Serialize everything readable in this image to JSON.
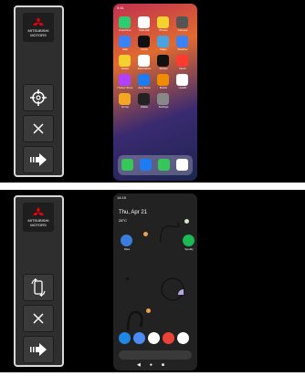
{
  "panels": [
    {
      "sidebar": {
        "logo_text_1": "MITSUBISHI",
        "logo_text_2": "MOTORS",
        "buttons": [
          "crosshair-icon",
          "close-icon",
          "forward-arrow-icon"
        ]
      },
      "phone": {
        "os": "ios",
        "status_time": "9:41",
        "app_labels": [
          "FaceTime",
          "Calendar",
          "Photos",
          "Camera",
          "Mail",
          "Clock",
          "Maps",
          "Weather",
          "Notes",
          "Reminders",
          "Stocks",
          "News",
          "iTunes Store",
          "App Store",
          "Books",
          "Health",
          "Home",
          "Wallet",
          "Settings"
        ],
        "dock_icons": [
          "phone-icon",
          "safari-icon",
          "messages-icon",
          "music-icon"
        ]
      }
    },
    {
      "sidebar": {
        "logo_text_1": "MITSUBISHI",
        "logo_text_2": "MOTORS",
        "buttons": [
          "rotate-phone-icon",
          "close-icon",
          "forward-arrow-icon"
        ]
      },
      "phone": {
        "os": "android",
        "status_time": "14:15",
        "date": "Thu, Apr 21",
        "temperature": "28°C",
        "app_labels": [
          "Files",
          "Spotify"
        ],
        "dock_icons": [
          "phone-icon",
          "messages-icon",
          "play-store-icon",
          "chrome-icon",
          "camera-icon"
        ]
      }
    }
  ]
}
